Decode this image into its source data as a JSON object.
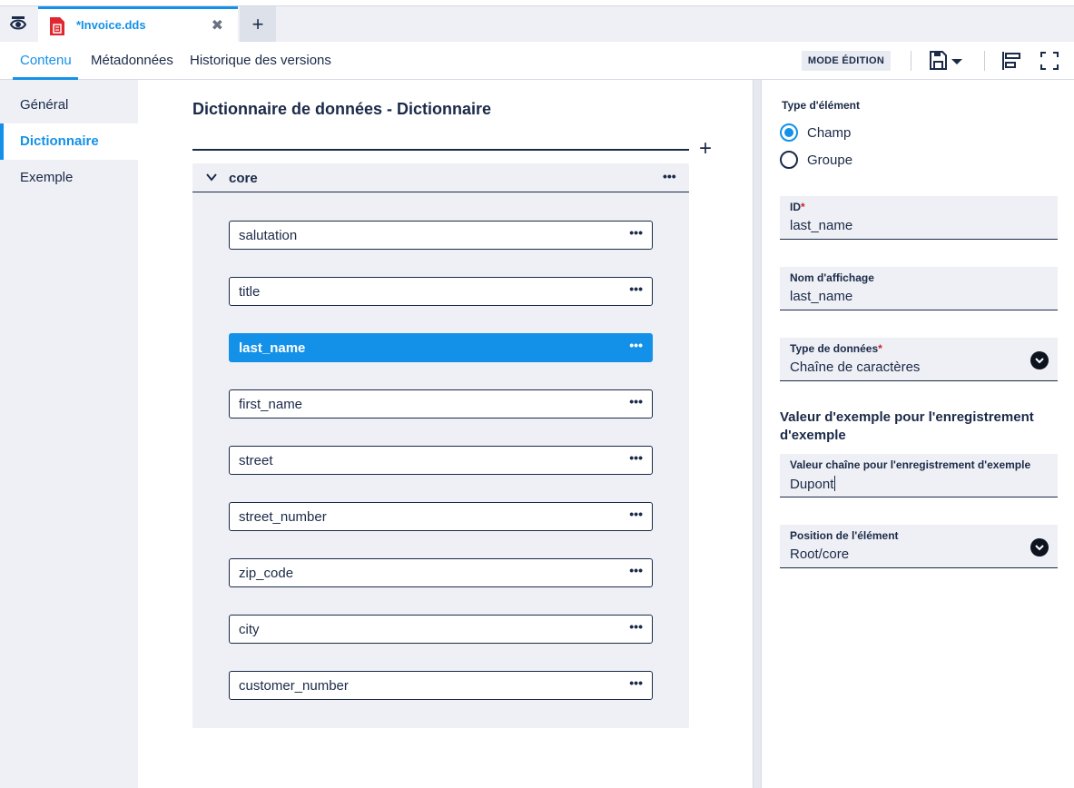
{
  "tab": {
    "title": "*Invoice.dds",
    "close": "✖",
    "new": "+"
  },
  "content_tabs": [
    "Contenu",
    "Métadonnées",
    "Historique des versions"
  ],
  "toolbar": {
    "mode_label": "MODE ÉDITION"
  },
  "nav": [
    "Général",
    "Dictionnaire",
    "Exemple"
  ],
  "main": {
    "title": "Dictionnaire de données - Dictionnaire",
    "add": "+",
    "group": {
      "label": "core",
      "menu": "•••"
    },
    "fields": [
      "salutation",
      "title",
      "last_name",
      "first_name",
      "street",
      "street_number",
      "zip_code",
      "city",
      "customer_number"
    ],
    "selected_field": "last_name",
    "field_menu": "•••"
  },
  "panel": {
    "element_type_label": "Type d'élément",
    "radio_field": "Champ",
    "radio_group": "Groupe",
    "selected_type": "Champ",
    "id_label": "ID",
    "id_required": "*",
    "id_value": "last_name",
    "display_label": "Nom d'affichage",
    "display_value": "last_name",
    "datatype_label": "Type de données",
    "datatype_required": "*",
    "datatype_value": "Chaîne de caractères",
    "example_heading": "Valeur d'exemple pour l'enregistrement d'exemple",
    "example_label": "Valeur chaîne pour l'enregistrement d'exemple",
    "example_value": "Dupont",
    "position_label": "Position de l'élément",
    "position_value": "Root/core"
  },
  "colors": {
    "accent": "#1391e8",
    "dark": "#1b2a48",
    "panel_bg": "#eef0f5",
    "file_icon": "#e0262f"
  }
}
